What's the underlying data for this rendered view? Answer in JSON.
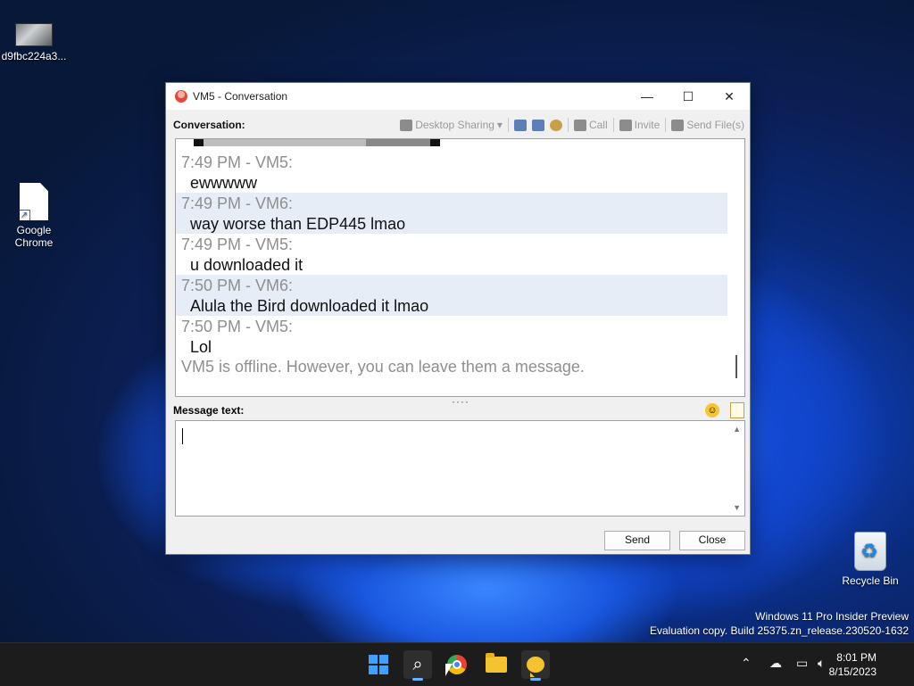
{
  "desktop": {
    "icons": [
      {
        "label": "d9fbc224a3..."
      },
      {
        "label": "Google Chrome"
      },
      {
        "label": "Recycle Bin"
      }
    ],
    "watermark": {
      "line1": "Windows 11 Pro Insider Preview",
      "line2": "Evaluation copy. Build 25375.zn_release.230520-1632"
    }
  },
  "window": {
    "title": "VM5 - Conversation",
    "controls": {
      "minimize": "—",
      "maximize": "☐",
      "close": "✕"
    },
    "conversation_label": "Conversation:",
    "toolbar": {
      "desktop_sharing": "Desktop Sharing",
      "call": "Call",
      "invite": "Invite",
      "send_files": "Send File(s)"
    },
    "messages": [
      {
        "meta": "7:49 PM - VM5:",
        "text": "ewwwww"
      },
      {
        "meta": "7:49 PM - VM6:",
        "text": "way worse than EDP445 lmao"
      },
      {
        "meta": "7:49 PM - VM5:",
        "text": "u downloaded it"
      },
      {
        "meta": "7:50 PM - VM6:",
        "text": "Alula the Bird downloaded it lmao"
      },
      {
        "meta": "7:50 PM - VM5:",
        "text": "Lol"
      }
    ],
    "offline_notice": "VM5 is offline. However, you can leave them a message.",
    "splitter_grip": "····",
    "message_text_label": "Message text:",
    "message_input_value": "",
    "send_label": "Send",
    "close_label": "Close"
  },
  "taskbar": {
    "clock_time": "8:01 PM",
    "clock_date": "8/15/2023"
  }
}
